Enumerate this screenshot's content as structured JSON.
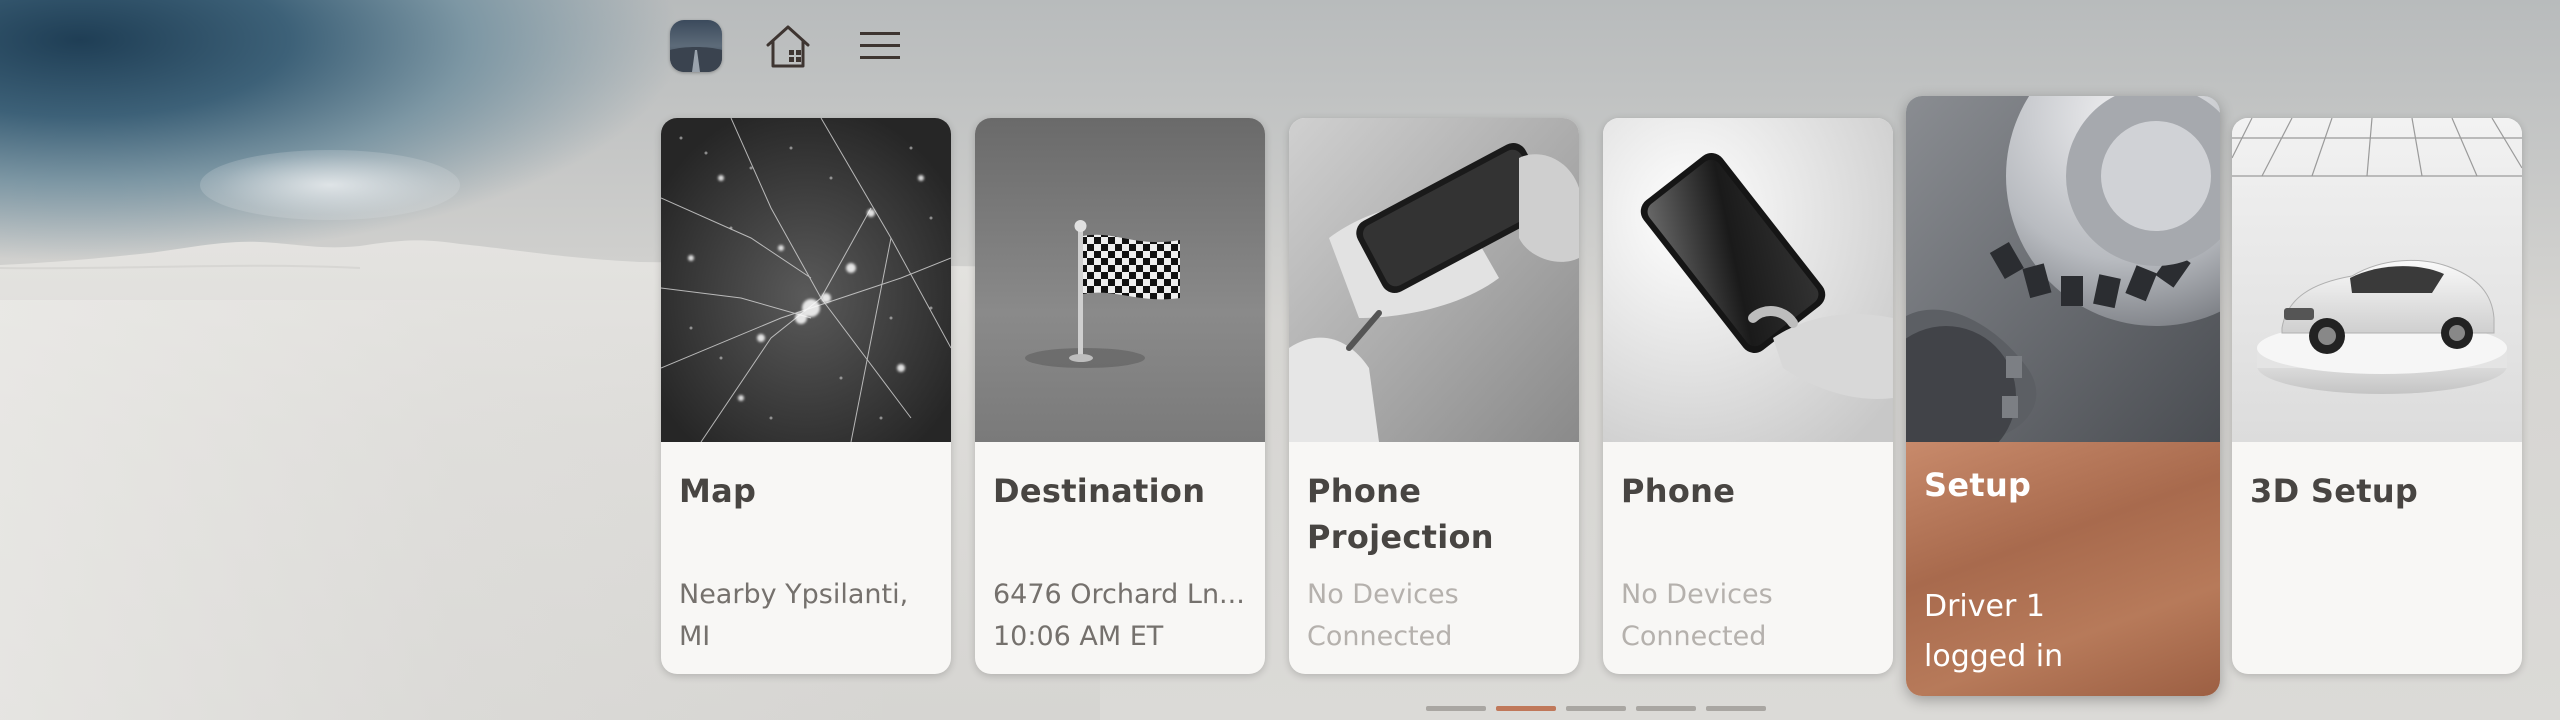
{
  "header": {
    "icons": [
      {
        "name": "driver-avatar-icon"
      },
      {
        "name": "home-icon"
      },
      {
        "name": "menu-icon"
      }
    ]
  },
  "cards": [
    {
      "title": "Map",
      "subtitle": [
        "Nearby Ypsilanti,",
        "MI"
      ],
      "muted": false
    },
    {
      "title": "Destination",
      "subtitle": [
        "6476 Orchard Ln...",
        "10:06 AM ET"
      ],
      "muted": false
    },
    {
      "title": "Phone Projection",
      "title_lines": [
        "Phone",
        "Projection"
      ],
      "subtitle": [
        "No Devices",
        "Connected"
      ],
      "muted": true
    },
    {
      "title": "Phone",
      "subtitle": [
        "No Devices",
        "Connected"
      ],
      "muted": true
    },
    {
      "title": "Setup",
      "subtitle": [
        "Driver 1",
        "logged in"
      ],
      "muted": false,
      "active": true
    },
    {
      "title": "3D Setup",
      "subtitle": [],
      "muted": false
    }
  ],
  "pagination": {
    "pages": 5,
    "active_index": 1
  },
  "colors": {
    "accent": "#c0785a",
    "setup_card": "#a86a4d",
    "card_bg": "#f8f7f5",
    "title_text": "#484542",
    "muted_text": "#b5b1ad"
  }
}
